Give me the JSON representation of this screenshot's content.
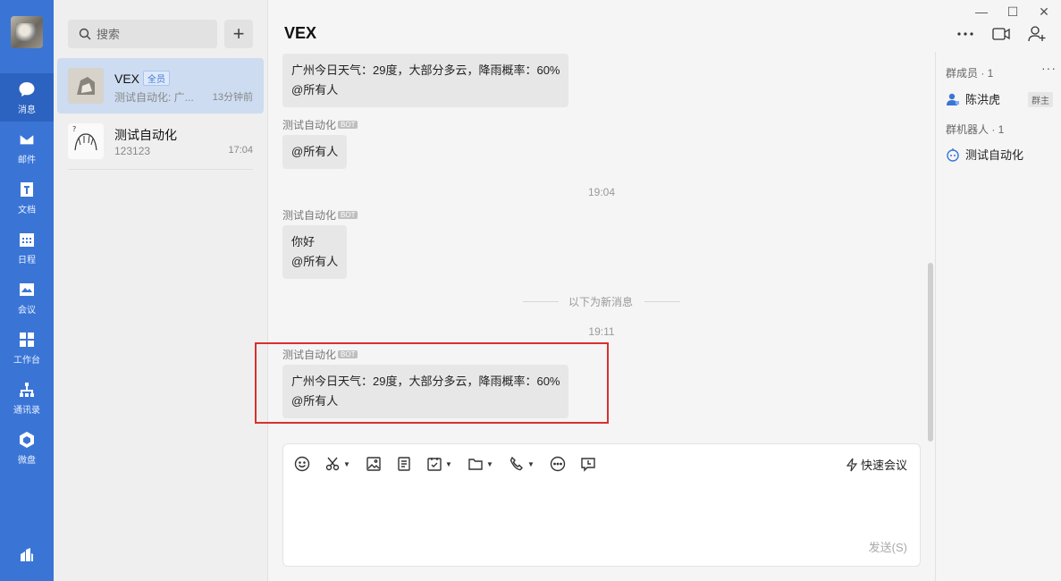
{
  "nav": {
    "items": [
      {
        "label": "消息"
      },
      {
        "label": "邮件"
      },
      {
        "label": "文档"
      },
      {
        "label": "日程"
      },
      {
        "label": "会议"
      },
      {
        "label": "工作台"
      },
      {
        "label": "通讯录"
      },
      {
        "label": "微盘"
      }
    ]
  },
  "search": {
    "placeholder": "搜索"
  },
  "conversations": [
    {
      "name": "VEX",
      "badge": "全员",
      "preview": "测试自动化: 广...",
      "time": "13分钟前"
    },
    {
      "name": "测试自动化",
      "preview": "123123",
      "time": "17:04"
    }
  ],
  "chat": {
    "title": "VEX",
    "messages": [
      {
        "line1": "广州今日天气：29度，大部分多云，降雨概率：60%",
        "line2": "@所有人"
      },
      {
        "sender": "测试自动化",
        "bot": "BOT",
        "line1": "@所有人"
      },
      {
        "time": "19:04"
      },
      {
        "sender": "测试自动化",
        "bot": "BOT",
        "line1": "你好",
        "line2": "@所有人"
      },
      {
        "divider": "以下为新消息"
      },
      {
        "time": "19:11"
      },
      {
        "sender": "测试自动化",
        "bot": "BOT",
        "line1": "广州今日天气：29度，大部分多云，降雨概率：60%",
        "line2": "@所有人"
      }
    ]
  },
  "editor": {
    "quick_meeting": "快速会议",
    "send": "发送(S)"
  },
  "members_panel": {
    "members_title": "群成员 · 1",
    "member_name": "陈洪虎",
    "owner_tag": "群主",
    "robots_title": "群机器人 · 1",
    "robot_name": "测试自动化"
  },
  "colors": {
    "rail": "#3a75d6",
    "highlight": "#d9302f",
    "active_conv": "#cddcf1"
  }
}
